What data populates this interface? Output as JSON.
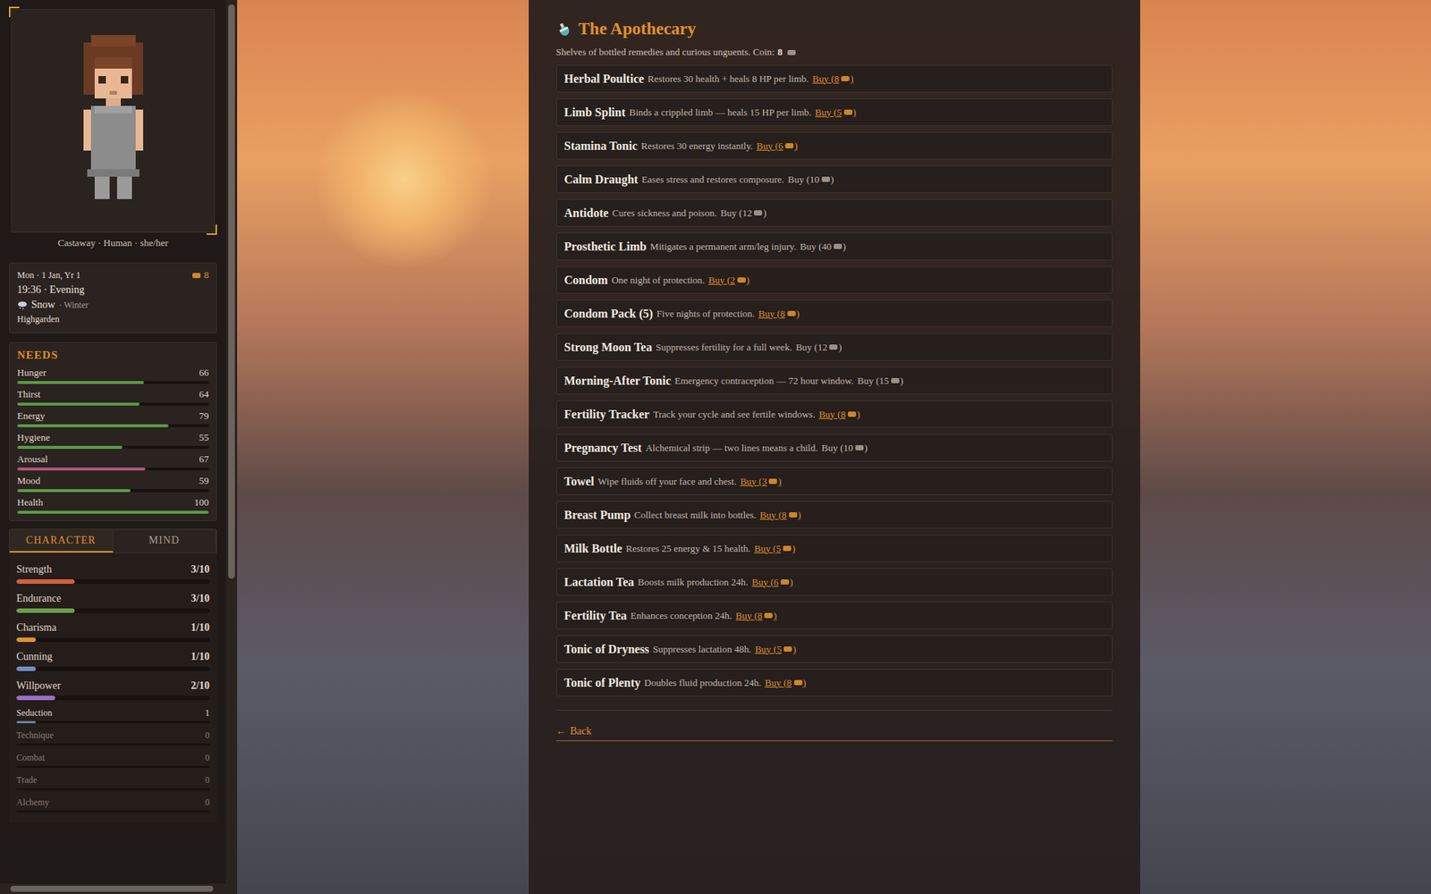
{
  "sidebar": {
    "portrait": {
      "caption": "Castaway · Human · she/her"
    },
    "info": {
      "date": "Mon · 1 Jan, Yr 1",
      "coin": "8",
      "time": "19:36 · Evening",
      "weather": "Snow",
      "season": "· Winter",
      "location": "Highgarden"
    },
    "needs": {
      "title": "NEEDS",
      "items": [
        {
          "label": "Hunger",
          "value": "66",
          "level": 0.66,
          "color": "#5a9a45"
        },
        {
          "label": "Thirst",
          "value": "64",
          "level": 0.64,
          "color": "#5a9a45"
        },
        {
          "label": "Energy",
          "value": "79",
          "level": 0.79,
          "color": "#5a9a45"
        },
        {
          "label": "Hygiene",
          "value": "55",
          "level": 0.55,
          "color": "#5a9a45"
        },
        {
          "label": "Arousal",
          "value": "67",
          "level": 0.67,
          "color": "#b0587a"
        },
        {
          "label": "Mood",
          "value": "59",
          "level": 0.59,
          "color": "#5a9a45"
        },
        {
          "label": "Health",
          "value": "100",
          "level": 1.0,
          "color": "#5a9a45"
        }
      ]
    },
    "tabs": [
      {
        "label": "CHARACTER",
        "selected": true
      },
      {
        "label": "MIND",
        "selected": false
      }
    ],
    "stats": [
      {
        "label": "Strength",
        "value": "3/10",
        "level": 0.3,
        "color": "#d2603f"
      },
      {
        "label": "Endurance",
        "value": "3/10",
        "level": 0.3,
        "color": "#6aa04a"
      },
      {
        "label": "Charisma",
        "value": "1/10",
        "level": 0.1,
        "color": "#e0902f"
      },
      {
        "label": "Cunning",
        "value": "1/10",
        "level": 0.1,
        "color": "#6f8fc0"
      },
      {
        "label": "Willpower",
        "value": "2/10",
        "level": 0.2,
        "color": "#9a6fc0"
      }
    ],
    "skills": [
      {
        "label": "Seduction",
        "value": "1",
        "level": 0.1,
        "dimmed": false
      },
      {
        "label": "Technique",
        "value": "0",
        "level": 0,
        "dimmed": true
      },
      {
        "label": "Combat",
        "value": "0",
        "level": 0,
        "dimmed": true
      },
      {
        "label": "Trade",
        "value": "0",
        "level": 0,
        "dimmed": true
      },
      {
        "label": "Alchemy",
        "value": "0",
        "level": 0,
        "dimmed": true
      }
    ]
  },
  "shop": {
    "title": "The Apothecary",
    "subtitle": "Shelves of bottled remedies and curious unguents. Coin:",
    "coin": "8",
    "items": [
      {
        "name": "Herbal Poultice",
        "description": "Restores 30 health + heals 8 HP per limb.",
        "buy_prefix": "Buy (8",
        "buy_suffix": ")",
        "affordable": true
      },
      {
        "name": "Limb Splint",
        "description": "Binds a crippled limb — heals 15 HP per limb.",
        "buy_prefix": "Buy (5",
        "buy_suffix": ")",
        "affordable": true
      },
      {
        "name": "Stamina Tonic",
        "description": "Restores 30 energy instantly.",
        "buy_prefix": "Buy (6",
        "buy_suffix": ")",
        "affordable": true
      },
      {
        "name": "Calm Draught",
        "description": "Eases stress and restores composure.",
        "buy_prefix": "Buy (10",
        "buy_suffix": ")",
        "affordable": false
      },
      {
        "name": "Antidote",
        "description": "Cures sickness and poison.",
        "buy_prefix": "Buy (12",
        "buy_suffix": ")",
        "affordable": false
      },
      {
        "name": "Prosthetic Limb",
        "description": "Mitigates a permanent arm/leg injury.",
        "buy_prefix": "Buy (40",
        "buy_suffix": ")",
        "affordable": false
      },
      {
        "name": "Condom",
        "description": "One night of protection.",
        "buy_prefix": "Buy (2",
        "buy_suffix": ")",
        "affordable": true
      },
      {
        "name": "Condom Pack (5)",
        "description": "Five nights of protection.",
        "buy_prefix": "Buy (8",
        "buy_suffix": ")",
        "affordable": true
      },
      {
        "name": "Strong Moon Tea",
        "description": "Suppresses fertility for a full week.",
        "buy_prefix": "Buy (12",
        "buy_suffix": ")",
        "affordable": false
      },
      {
        "name": "Morning-After Tonic",
        "description": "Emergency contraception — 72 hour window.",
        "buy_prefix": "Buy (15",
        "buy_suffix": ")",
        "affordable": false
      },
      {
        "name": "Fertility Tracker",
        "description": "Track your cycle and see fertile windows.",
        "buy_prefix": "Buy (8",
        "buy_suffix": ")",
        "affordable": true
      },
      {
        "name": "Pregnancy Test",
        "description": "Alchemical strip — two lines means a child.",
        "buy_prefix": "Buy (10",
        "buy_suffix": ")",
        "affordable": false
      },
      {
        "name": "Towel",
        "description": "Wipe fluids off your face and chest.",
        "buy_prefix": "Buy (3",
        "buy_suffix": ")",
        "affordable": true
      },
      {
        "name": "Breast Pump",
        "description": "Collect breast milk into bottles.",
        "buy_prefix": "Buy (8",
        "buy_suffix": ")",
        "affordable": true
      },
      {
        "name": "Milk Bottle",
        "description": "Restores 25 energy & 15 health.",
        "buy_prefix": "Buy (5",
        "buy_suffix": ")",
        "affordable": true
      },
      {
        "name": "Lactation Tea",
        "description": "Boosts milk production 24h.",
        "buy_prefix": "Buy (6",
        "buy_suffix": ")",
        "affordable": true
      },
      {
        "name": "Fertility Tea",
        "description": "Enhances conception 24h.",
        "buy_prefix": "Buy (8",
        "buy_suffix": ")",
        "affordable": true
      },
      {
        "name": "Tonic of Dryness",
        "description": "Suppresses lactation 48h.",
        "buy_prefix": "Buy (5",
        "buy_suffix": ")",
        "affordable": true
      },
      {
        "name": "Tonic of Plenty",
        "description": "Doubles fluid production 24h.",
        "buy_prefix": "Buy (8",
        "buy_suffix": ")",
        "affordable": true
      }
    ],
    "back": {
      "arrow": "←",
      "label": "Back"
    }
  }
}
